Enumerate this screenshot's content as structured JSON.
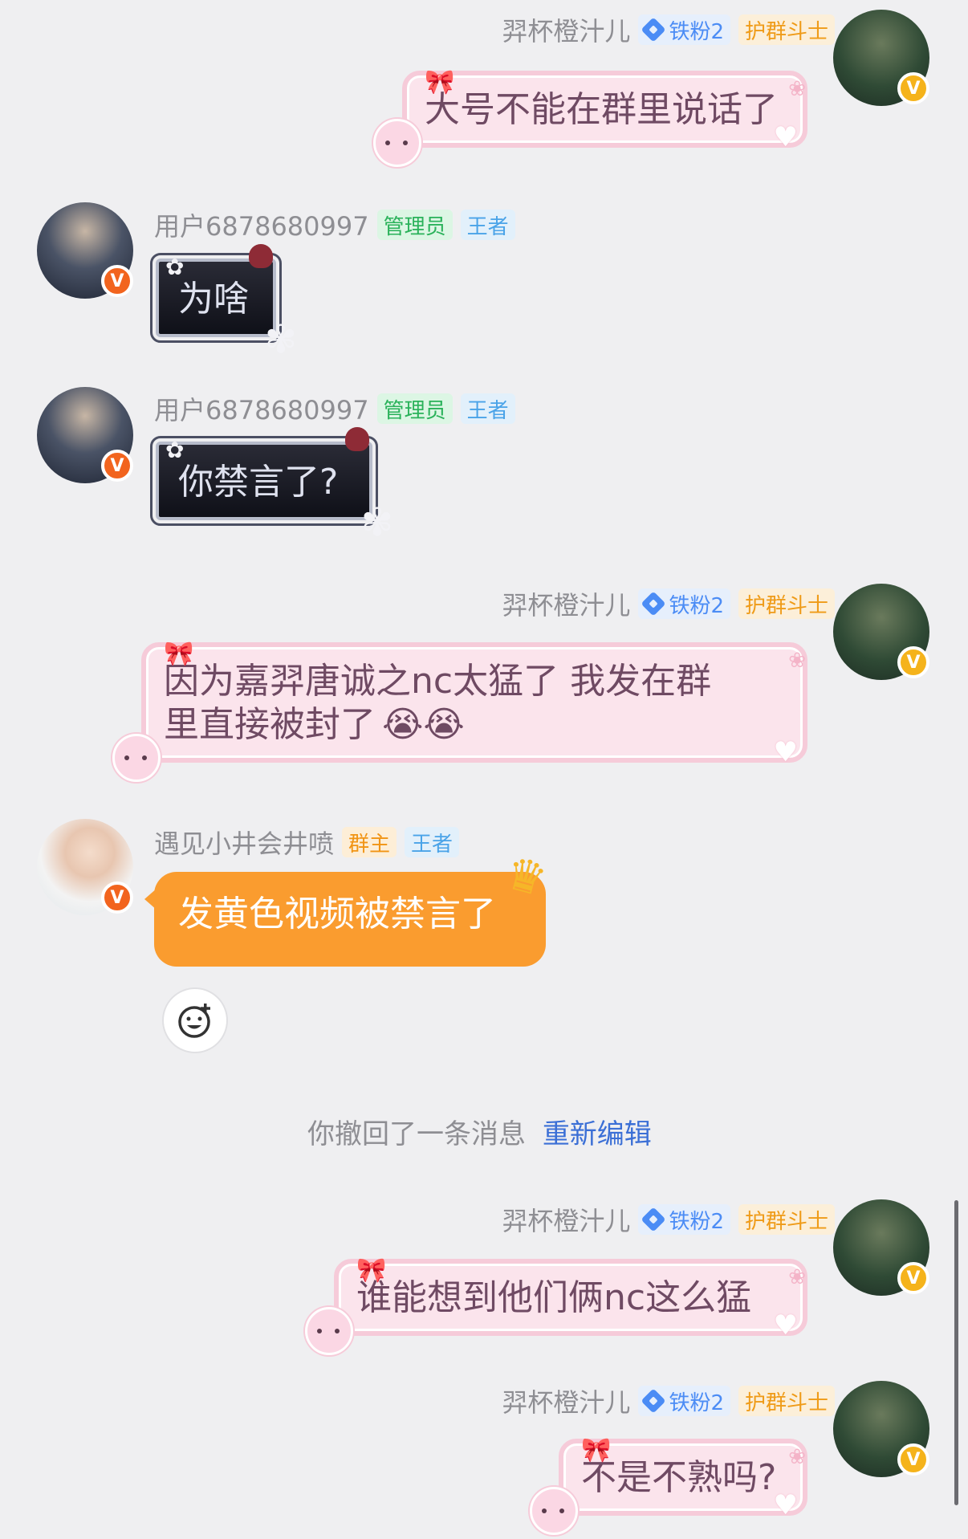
{
  "messages": {
    "m1": {
      "sender": "羿杯橙汁儿",
      "fan_badge": "铁粉2",
      "role_badge": "护群斗士",
      "text": "大号不能在群里说话了"
    },
    "m2": {
      "sender": "用户6878680997",
      "role_badge": "管理员",
      "rank_badge": "王者",
      "text": "为啥"
    },
    "m3": {
      "sender": "用户6878680997",
      "role_badge": "管理员",
      "rank_badge": "王者",
      "text": "你禁言了?"
    },
    "m4": {
      "sender": "羿杯橙汁儿",
      "fan_badge": "铁粉2",
      "role_badge": "护群斗士",
      "line1": "因为嘉羿唐诚之nc太猛了 我发在群",
      "line2": "里直接被封了",
      "emoji": "😭😭"
    },
    "m5": {
      "sender": "遇见小井会井喷",
      "role_badge": "群主",
      "rank_badge": "王者",
      "text": "发黄色视频被禁言了"
    },
    "m6": {
      "sender": "羿杯橙汁儿",
      "fan_badge": "铁粉2",
      "role_badge": "护群斗士",
      "text": "谁能想到他们俩nc这么猛"
    },
    "m7": {
      "sender": "羿杯橙汁儿",
      "fan_badge": "铁粉2",
      "role_badge": "护群斗士",
      "text": "不是不熟吗?"
    }
  },
  "recall_notice": {
    "text": "你撤回了一条消息",
    "action": "重新编辑"
  },
  "verified_mark": "V",
  "icons": {
    "reaction": "emoji-add-icon",
    "crown": "crown-icon",
    "fan_badge": "diamond-icon"
  },
  "colors": {
    "background": "#efeff1",
    "orange_bubble": "#fa9c2f",
    "pink_bubble": "#fbe4ec",
    "link": "#3b6fd6"
  }
}
